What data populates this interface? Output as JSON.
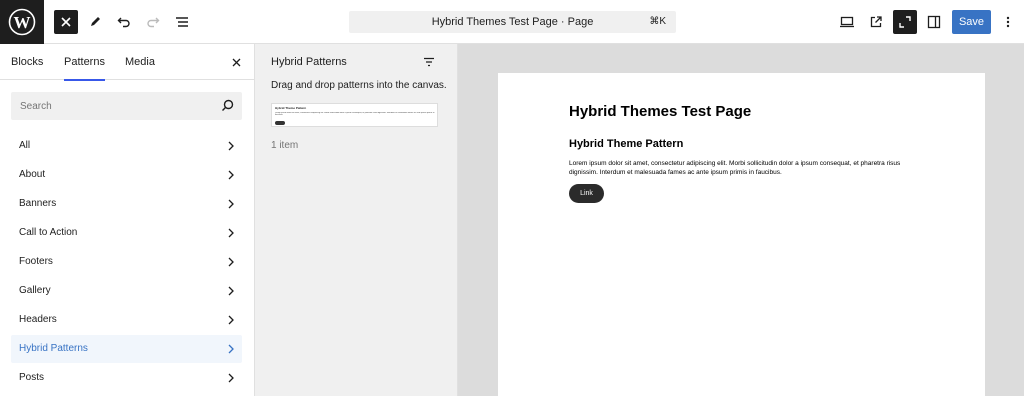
{
  "toolbar": {
    "document_title": "Hybrid Themes Test Page · Page",
    "shortcut": "⌘K",
    "save_label": "Save"
  },
  "inserter": {
    "tabs": [
      {
        "label": "Blocks"
      },
      {
        "label": "Patterns"
      },
      {
        "label": "Media"
      }
    ],
    "search_placeholder": "Search",
    "categories": [
      {
        "label": "All"
      },
      {
        "label": "About"
      },
      {
        "label": "Banners"
      },
      {
        "label": "Call to Action"
      },
      {
        "label": "Footers"
      },
      {
        "label": "Gallery"
      },
      {
        "label": "Headers"
      },
      {
        "label": "Hybrid Patterns"
      },
      {
        "label": "Posts"
      }
    ]
  },
  "patterns_panel": {
    "title": "Hybrid Patterns",
    "description": "Drag and drop patterns into the canvas.",
    "count": "1 item"
  },
  "canvas": {
    "page_title": "Hybrid Themes Test Page",
    "pattern_heading": "Hybrid Theme Pattern",
    "paragraph": "Lorem ipsum dolor sit amet, consectetur adipiscing elit. Morbi sollicitudin dolor a ipsum consequat, et pharetra risus dignissim. Interdum et malesuada fames ac ante ipsum primis in faucibus.",
    "button_label": "Link"
  },
  "colors": {
    "accent_blue": "#3873c4",
    "tab_indicator": "#3858e9",
    "dark": "#1e1e1e"
  }
}
